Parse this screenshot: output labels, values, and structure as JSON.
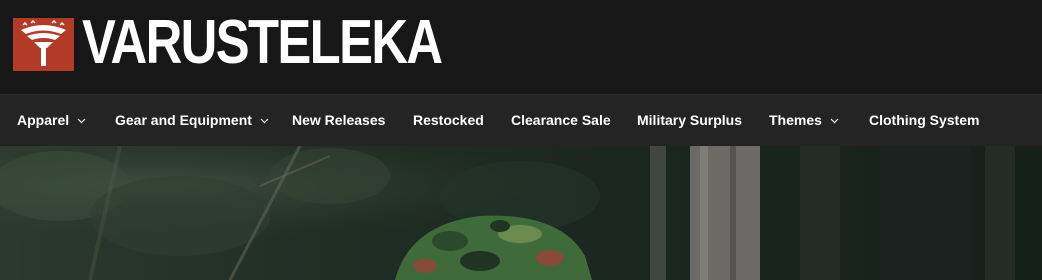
{
  "header": {
    "brand_name": "VARUSTELEKA",
    "logo_icon": "varusteleka-emblem-icon",
    "colors": {
      "background": "#181717",
      "logo_red": "#b23a26"
    }
  },
  "nav": {
    "items": [
      {
        "label": "Apparel",
        "has_dropdown": true
      },
      {
        "label": "Gear and Equipment",
        "has_dropdown": true
      },
      {
        "label": "New Releases",
        "has_dropdown": false
      },
      {
        "label": "Restocked",
        "has_dropdown": false
      },
      {
        "label": "Clearance Sale",
        "has_dropdown": false
      },
      {
        "label": "Military Surplus",
        "has_dropdown": false
      },
      {
        "label": "Themes",
        "has_dropdown": true
      },
      {
        "label": "Clothing System",
        "has_dropdown": false
      }
    ],
    "dropdown_icon": "chevron-down-icon",
    "colors": {
      "background": "#242424",
      "text": "#ffffff"
    }
  },
  "hero": {
    "image": "forest-camouflage-hat-photo"
  }
}
